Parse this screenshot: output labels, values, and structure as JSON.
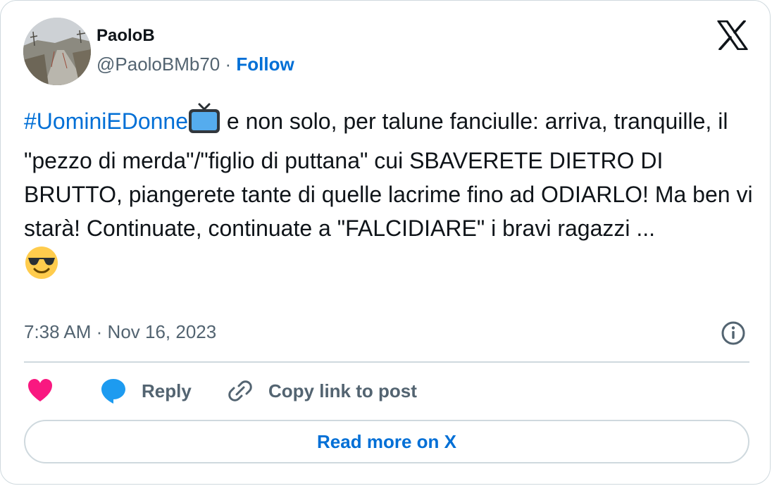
{
  "author": {
    "display_name": "PaoloB",
    "handle": "@PaoloBMb70",
    "separator": "·",
    "follow_label": "Follow",
    "avatar_icon": "avatar-photo-road-landscape"
  },
  "platform_logo": "x-logo-icon",
  "tweet": {
    "hashtag": "#UominiEDonne",
    "hashtag_emoji": "television-icon",
    "text_after_hashtag": " e non solo, per talune fanciulle: arriva, tranquille, il \"pezzo di merda\"/\"figlio di puttana\" cui SBAVERETE DIETRO DI BRUTTO, piangerete tante di quelle lacrime fino ad ODIARLO! Ma ben vi starà! Continuate,  continuate a \"FALCIDIARE\" i bravi ragazzi  ...",
    "trailing_emoji": "smiling-face-with-sunglasses-icon"
  },
  "meta": {
    "time": "7:38 AM",
    "separator": "·",
    "date": "Nov 16, 2023"
  },
  "actions": {
    "like_icon": "heart-icon",
    "reply_label": "Reply",
    "copy_link_label": "Copy link to post"
  },
  "read_more_label": "Read more on X",
  "colors": {
    "link_blue": "#006fd6",
    "secondary_text": "#536471",
    "border": "#cfd9de",
    "like_pink": "#f91880",
    "reply_blue": "#1d9bf0"
  }
}
